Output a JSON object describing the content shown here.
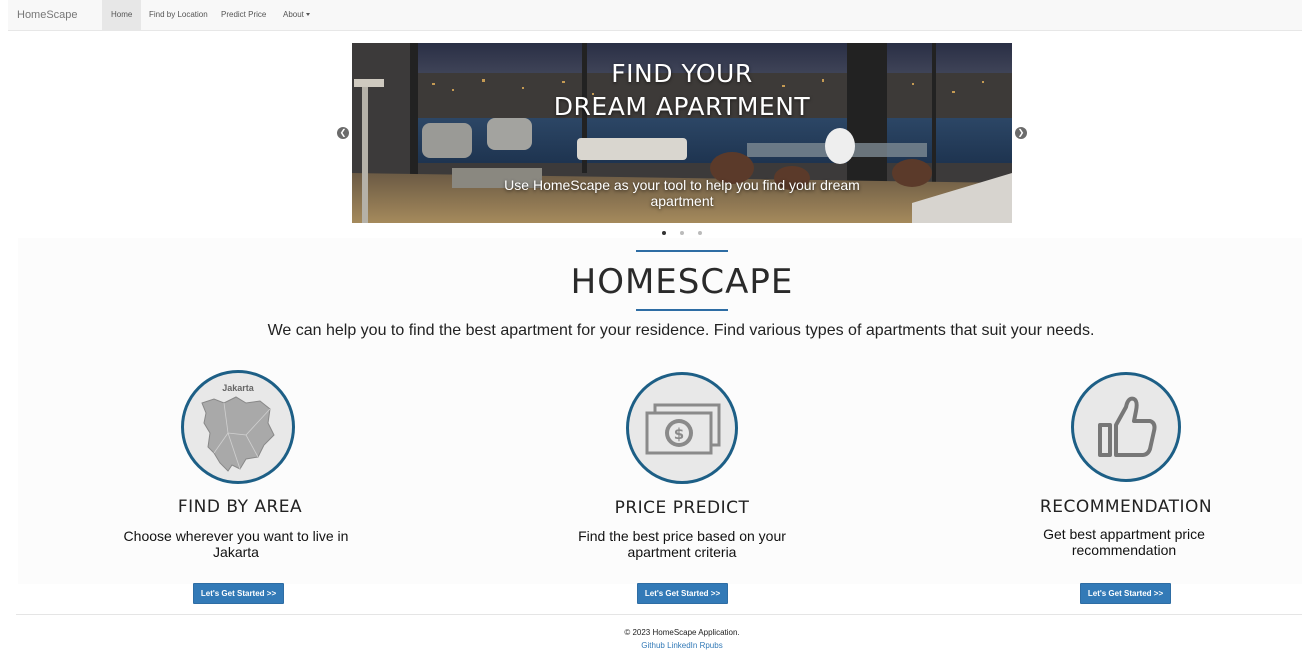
{
  "navbar": {
    "brand": "HomeScape",
    "items": [
      {
        "label": "Home",
        "active": true
      },
      {
        "label": "Find by Location",
        "active": false
      },
      {
        "label": "Predict Price",
        "active": false
      },
      {
        "label": "About",
        "active": false,
        "dropdown": true
      }
    ]
  },
  "carousel": {
    "title_line1": "FIND YOUR",
    "title_line2": "DREAM APARTMENT",
    "subtitle": "Use HomeScape as your tool to help you find your dream apartment",
    "prev_icon": "chevron-left-icon",
    "next_icon": "chevron-right-icon",
    "slide_count": 3,
    "active_slide": 1
  },
  "intro": {
    "title": "HOMESCAPE",
    "text": "We can help you to find the best apartment for your residence. Find various types of apartments that suit your needs."
  },
  "features": [
    {
      "icon": "jakarta-map-icon",
      "map_label": "Jakarta",
      "title": "FIND BY AREA",
      "description": "Choose wherever you want to live in Jakarta",
      "button": "Let's Get Started >>"
    },
    {
      "icon": "money-icon",
      "title": "PRICE PREDICT",
      "description": "Find the best price based on your apartment criteria",
      "button": "Let's Get Started >>"
    },
    {
      "icon": "thumbs-up-icon",
      "title": "RECOMMENDATION",
      "description": "Get best appartment price recommendation",
      "button": "Let's Get Started >>"
    }
  ],
  "footer": {
    "copyright": "© 2023 HomeScape Application.",
    "links": [
      "Github",
      "LinkedIn",
      "Rpubs"
    ]
  },
  "colors": {
    "accent": "#337ab7",
    "circle_border": "#1d5f86",
    "rule": "#2e6da4"
  }
}
